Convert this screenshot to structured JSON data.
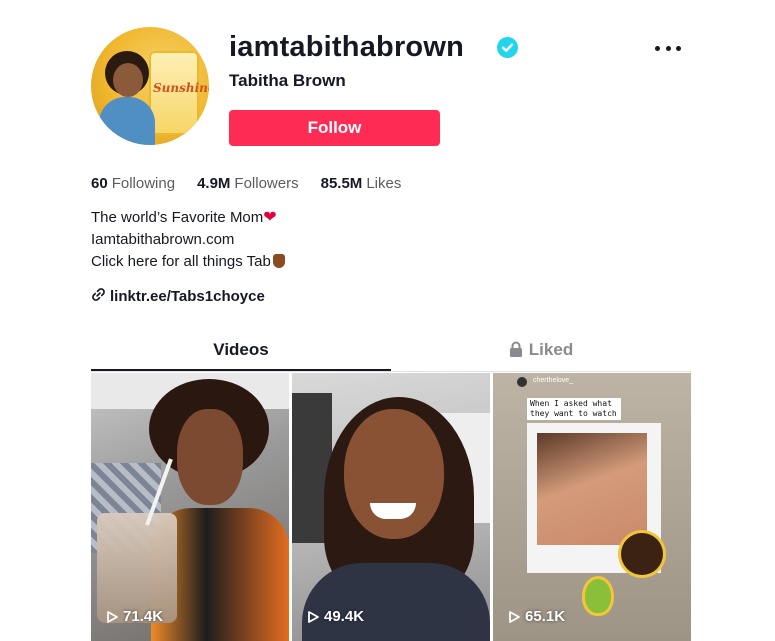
{
  "profile": {
    "username": "iamtabithabrown",
    "nickname": "Tabitha Brown",
    "follow_label": "Follow",
    "avatar_text": "Sunshine",
    "verified_icon": "verified-badge-icon",
    "accent_color": "#fe2c55",
    "verified_color": "#20d5ec"
  },
  "stats": {
    "following_count": "60",
    "following_label": "Following",
    "followers_count": "4.9M",
    "followers_label": "Followers",
    "likes_count": "85.5M",
    "likes_label": "Likes"
  },
  "bio": {
    "line1": "The world’s Favorite Mom",
    "line2": "Iamtabithabrown.com",
    "line3": "Click here for all things Tab"
  },
  "link": {
    "text": "linktr.ee/Tabs1choyce",
    "icon": "link-icon"
  },
  "tabs": [
    {
      "label": "Videos",
      "active": true
    },
    {
      "label": "Liked",
      "active": false,
      "icon": "lock-icon"
    }
  ],
  "videos": [
    {
      "views": "71.4K"
    },
    {
      "views": "49.4K"
    },
    {
      "views": "65.1K",
      "overlay_text": "When I asked what they want to watch",
      "handle": "cherthelove_"
    }
  ]
}
